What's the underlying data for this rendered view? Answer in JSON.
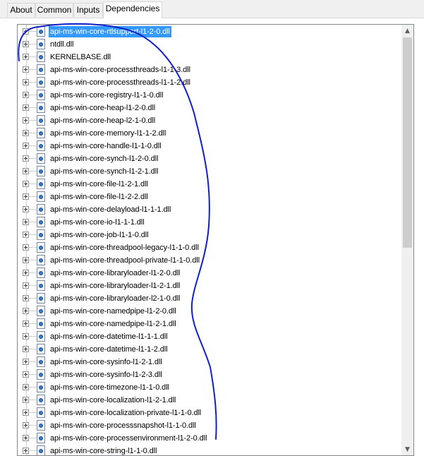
{
  "tabs": [
    {
      "label": "About",
      "active": false
    },
    {
      "label": "Common",
      "active": false
    },
    {
      "label": "Inputs",
      "active": false
    },
    {
      "label": "Dependencies",
      "active": true
    }
  ],
  "tree": {
    "selected_index": 0,
    "items": [
      "api-ms-win-core-rtlsupport-l1-2-0.dll",
      "ntdll.dll",
      "KERNELBASE.dll",
      "api-ms-win-core-processthreads-l1-1-3.dll",
      "api-ms-win-core-processthreads-l1-1-2.dll",
      "api-ms-win-core-registry-l1-1-0.dll",
      "api-ms-win-core-heap-l1-2-0.dll",
      "api-ms-win-core-heap-l2-1-0.dll",
      "api-ms-win-core-memory-l1-1-2.dll",
      "api-ms-win-core-handle-l1-1-0.dll",
      "api-ms-win-core-synch-l1-2-0.dll",
      "api-ms-win-core-synch-l1-2-1.dll",
      "api-ms-win-core-file-l1-2-1.dll",
      "api-ms-win-core-file-l1-2-2.dll",
      "api-ms-win-core-delayload-l1-1-1.dll",
      "api-ms-win-core-io-l1-1-1.dll",
      "api-ms-win-core-job-l1-1-0.dll",
      "api-ms-win-core-threadpool-legacy-l1-1-0.dll",
      "api-ms-win-core-threadpool-private-l1-1-0.dll",
      "api-ms-win-core-libraryloader-l1-2-0.dll",
      "api-ms-win-core-libraryloader-l1-2-1.dll",
      "api-ms-win-core-libraryloader-l2-1-0.dll",
      "api-ms-win-core-namedpipe-l1-2-0.dll",
      "api-ms-win-core-namedpipe-l1-2-1.dll",
      "api-ms-win-core-datetime-l1-1-1.dll",
      "api-ms-win-core-datetime-l1-1-2.dll",
      "api-ms-win-core-sysinfo-l1-2-1.dll",
      "api-ms-win-core-sysinfo-l1-2-3.dll",
      "api-ms-win-core-timezone-l1-1-0.dll",
      "api-ms-win-core-localization-l1-2-1.dll",
      "api-ms-win-core-localization-private-l1-1-0.dll",
      "api-ms-win-core-processsnapshot-l1-1-0.dll",
      "api-ms-win-core-processenvironment-l1-2-0.dll",
      "api-ms-win-core-string-l1-1-0.dll"
    ]
  },
  "scrollbar": {
    "up_icon": "▲",
    "down_icon": "▼"
  },
  "colors": {
    "selection": "#3399ff",
    "annotation_stroke": "#1020c8"
  }
}
